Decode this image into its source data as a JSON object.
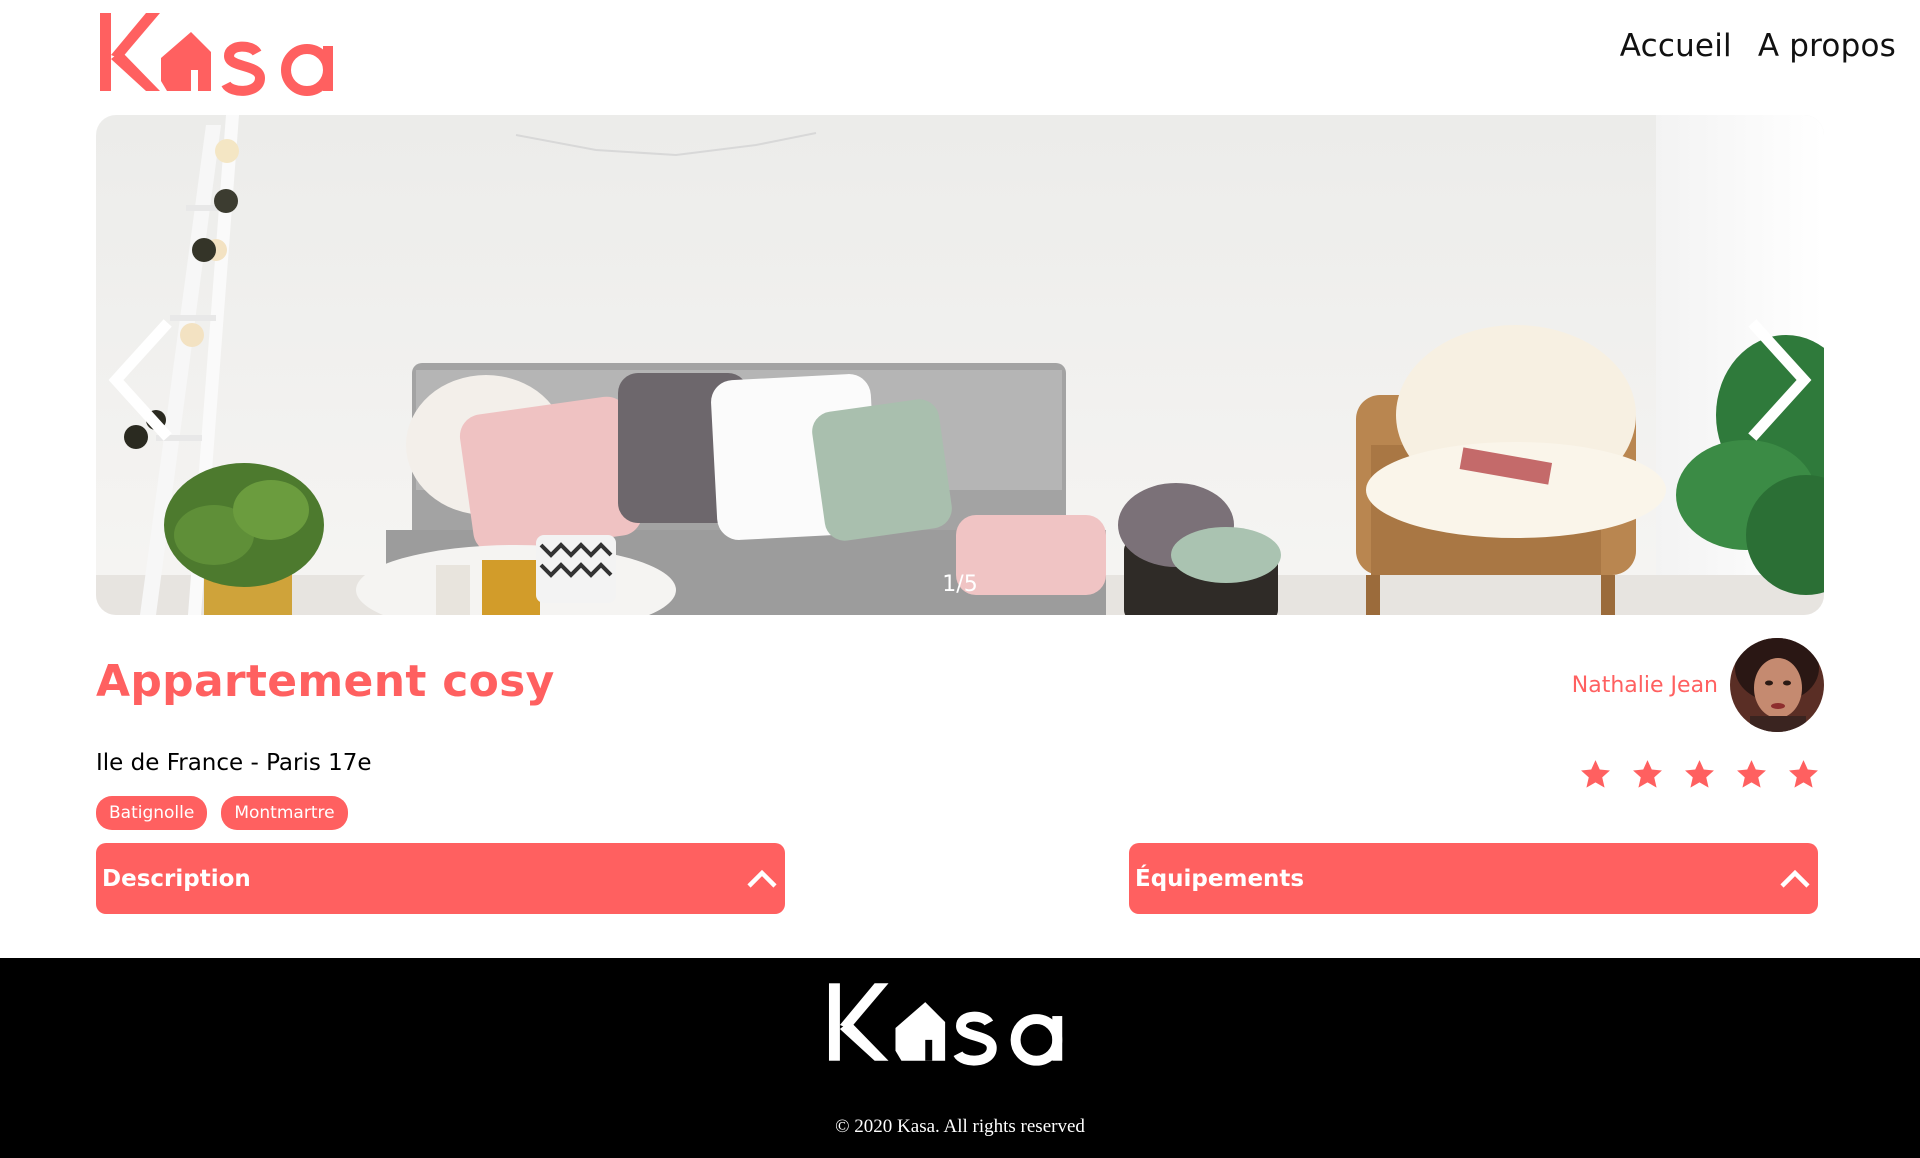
{
  "header": {
    "logo_text": "Kasa",
    "nav": [
      {
        "label": "Accueil"
      },
      {
        "label": "A propos"
      }
    ]
  },
  "carousel": {
    "counter": "1/5",
    "current": 1,
    "total": 5
  },
  "listing": {
    "title": "Appartement cosy",
    "location": "Ile de France - Paris 17e",
    "tags": [
      "Batignolle",
      "Montmartre"
    ],
    "host_name": "Nathalie Jean",
    "rating": 5,
    "rating_max": 5
  },
  "collapses": {
    "description_label": "Description",
    "equipment_label": "Équipements"
  },
  "footer": {
    "logo_text": "Kasa",
    "copyright": "© 2020 Kasa. All rights reserved"
  },
  "colors": {
    "brand": "#ff6060",
    "footer_bg": "#000000",
    "text": "#000000"
  },
  "icons": {
    "prev": "chevron-left-icon",
    "next": "chevron-right-icon",
    "collapse": "chevron-up-icon",
    "rating": "star-icon"
  }
}
